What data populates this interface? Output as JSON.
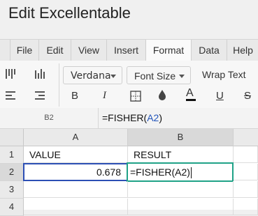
{
  "app": {
    "title": "Edit Excellentable"
  },
  "tabs": [
    {
      "label": "File"
    },
    {
      "label": "Edit"
    },
    {
      "label": "View"
    },
    {
      "label": "Insert"
    },
    {
      "label": "Format",
      "active": true
    },
    {
      "label": "Data"
    },
    {
      "label": "Help"
    }
  ],
  "ribbon": {
    "font_family": "Verdana",
    "font_size_label": "Font Size",
    "wrap_text_label": "Wrap Text",
    "bold_label": "B",
    "italic_label": "I",
    "underline_label": "U",
    "strike_label": "S",
    "font_color_label": "A"
  },
  "formula_bar": {
    "cell_ref": "B2",
    "formula_prefix": "=FISHER(",
    "formula_ref": "A2",
    "formula_suffix": ")"
  },
  "grid": {
    "columns": [
      "A",
      "B"
    ],
    "rows": [
      "1",
      "2",
      "3",
      "4"
    ],
    "cells": {
      "A1": "VALUE",
      "B1": "RESULT",
      "A2": "0.678",
      "B2": "=FISHER(A2)"
    }
  },
  "colors": {
    "selection": "#2c4fb5",
    "edit": "#1fa287",
    "ref_text": "#2255bb"
  }
}
